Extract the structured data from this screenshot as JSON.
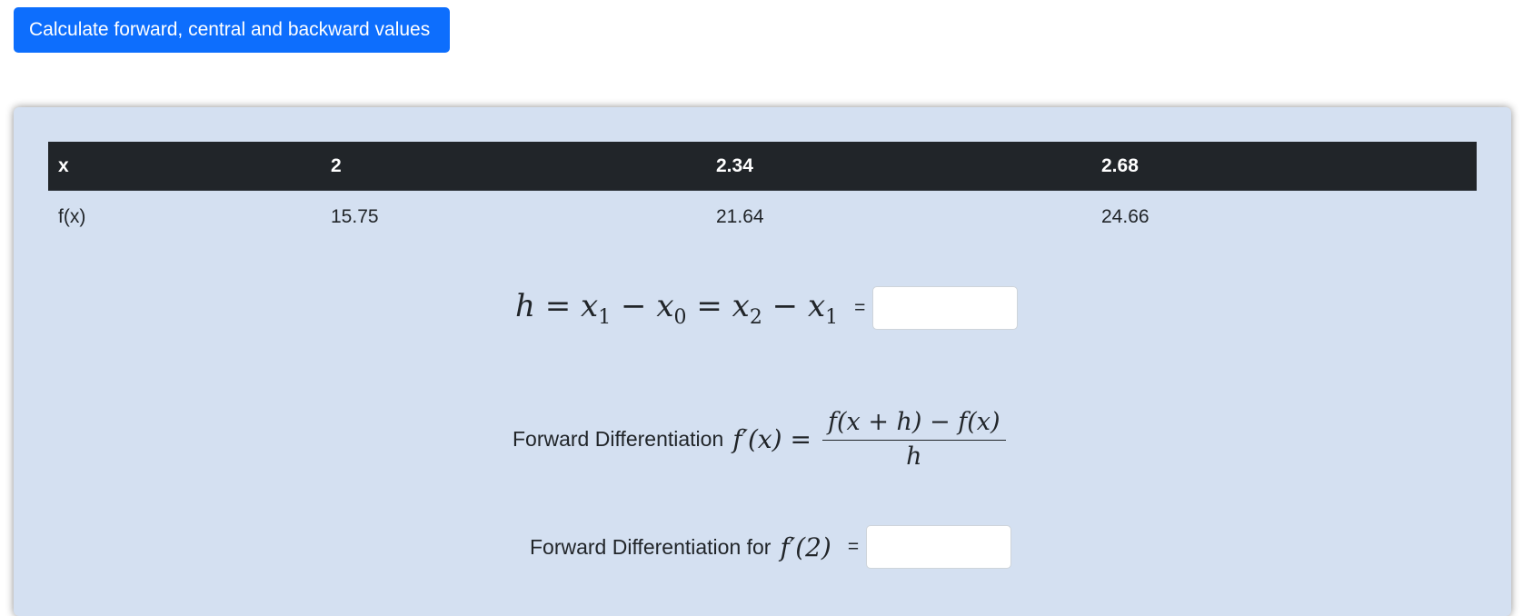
{
  "top_button": {
    "label": "Calculate forward, central and backward values",
    "color": "#0d6efd"
  },
  "card": {
    "background": "#d4e0f1"
  },
  "table": {
    "header": [
      "x",
      "2",
      "2.34",
      "2.68"
    ],
    "row": [
      "f(x)",
      "15.75",
      "21.64",
      "24.66"
    ]
  },
  "h_formula": {
    "h": "h",
    "equals1": "=",
    "x1a": "x",
    "sub1a": "1",
    "minus1": "−",
    "x0": "x",
    "sub0": "0",
    "equals2": "=",
    "x2": "x",
    "sub2": "2",
    "minus2": "−",
    "x1b": "x",
    "sub1b": "1",
    "equals_label": "=",
    "input_value": ""
  },
  "forward_formula": {
    "label": "Forward Differentiation",
    "lhs": "f′(x) =",
    "numerator": "f(x + h) − f(x)",
    "denominator": "h"
  },
  "forward_at_2": {
    "label": "Forward Differentiation for",
    "expr": "f′(2)",
    "equals_label": "=",
    "input_value": ""
  }
}
